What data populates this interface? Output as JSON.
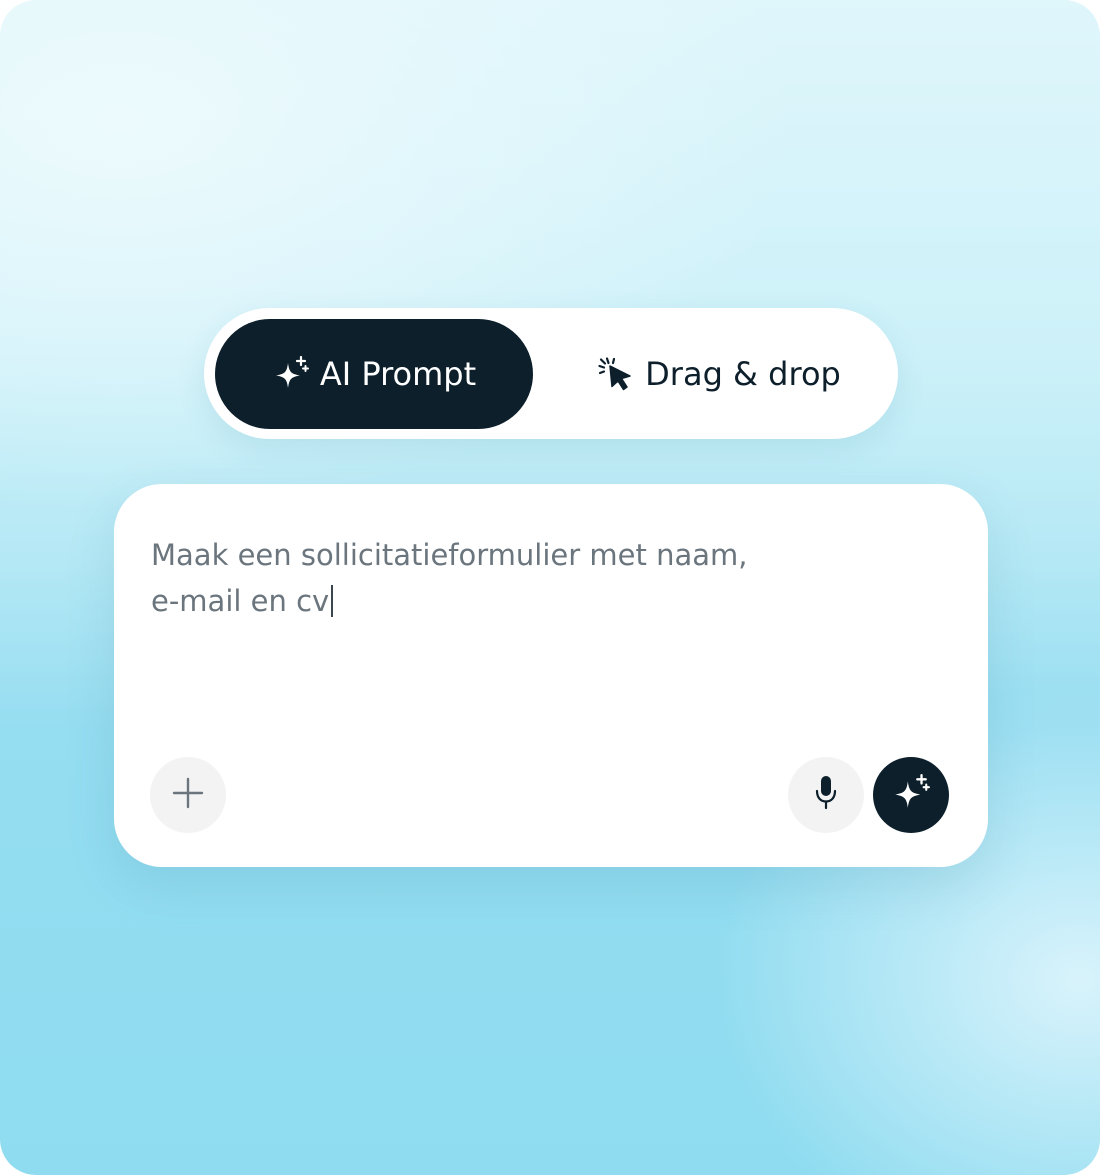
{
  "mode_toggle": {
    "options": [
      {
        "label": "AI Prompt",
        "icon": "sparkle-icon",
        "selected": true
      },
      {
        "label": "Drag & drop",
        "icon": "cursor-click-icon",
        "selected": false
      }
    ]
  },
  "prompt_box": {
    "text_line1": "Maak een sollicitatieformulier met naam,",
    "text_line2": "e-mail en cv",
    "add_icon": "plus-icon",
    "mic_icon": "microphone-icon",
    "submit_icon": "sparkle-icon"
  },
  "colors": {
    "dark": "#0c1f2b",
    "text_muted": "#6a757d",
    "button_gray": "#f3f3f4",
    "background_top": "#dff6fb",
    "background_bottom": "#8fdcf0"
  }
}
